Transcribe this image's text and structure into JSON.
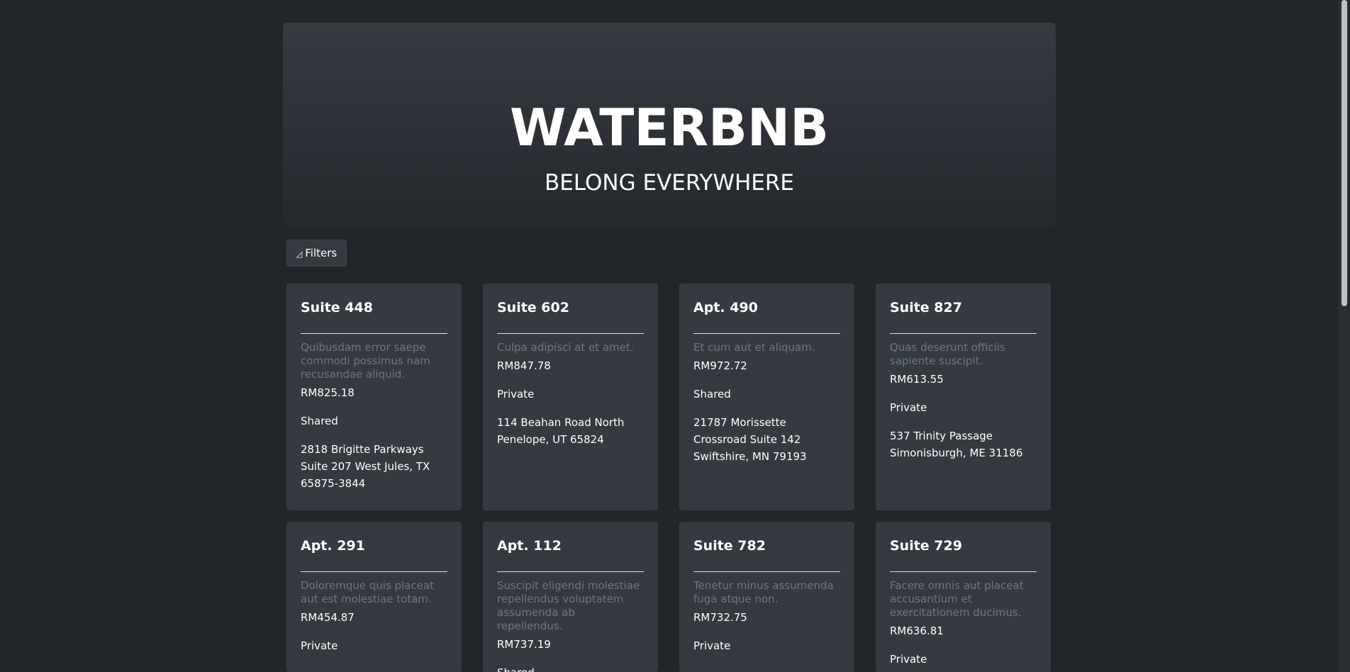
{
  "header": {
    "title": "WATERBNB",
    "subtitle": "BELONG EVERYWHERE"
  },
  "filters": {
    "icon": "filter-icon",
    "label": "Filters"
  },
  "listings": [
    {
      "name": "Suite 448",
      "description": "Quibusdam error saepe commodi possimus nam recusandae aliquid.",
      "price": "RM825.18",
      "type": "Shared",
      "address": "2818 Brigitte Parkways Suite 207 West Jules, TX 65875-3844"
    },
    {
      "name": "Suite 602",
      "description": "Culpa adipisci at et amet.",
      "price": "RM847.78",
      "type": "Private",
      "address": "114 Beahan Road North Penelope, UT 65824"
    },
    {
      "name": "Apt. 490",
      "description": "Et cum aut et aliquam.",
      "price": "RM972.72",
      "type": "Shared",
      "address": "21787 Morissette Crossroad Suite 142 Swiftshire, MN 79193"
    },
    {
      "name": "Suite 827",
      "description": "Quas deserunt officiis sapiente suscipit.",
      "price": "RM613.55",
      "type": "Private",
      "address": "537 Trinity Passage Simonisburgh, ME 31186"
    },
    {
      "name": "Apt. 291",
      "description": "Doloremque quis placeat aut est molestiae totam.",
      "price": "RM454.87",
      "type": "Private",
      "address": ""
    },
    {
      "name": "Apt. 112",
      "description": "Suscipit eligendi molestiae repellendus voluptatem assumenda ab repellendus.",
      "price": "RM737.19",
      "type": "Shared",
      "address": ""
    },
    {
      "name": "Suite 782",
      "description": "Tenetur minus assumenda fuga atque non.",
      "price": "RM732.75",
      "type": "Private",
      "address": ""
    },
    {
      "name": "Suite 729",
      "description": "Facere omnis aut placeat accusantium et exercitationem ducimus.",
      "price": "RM636.81",
      "type": "Private",
      "address": ""
    }
  ]
}
